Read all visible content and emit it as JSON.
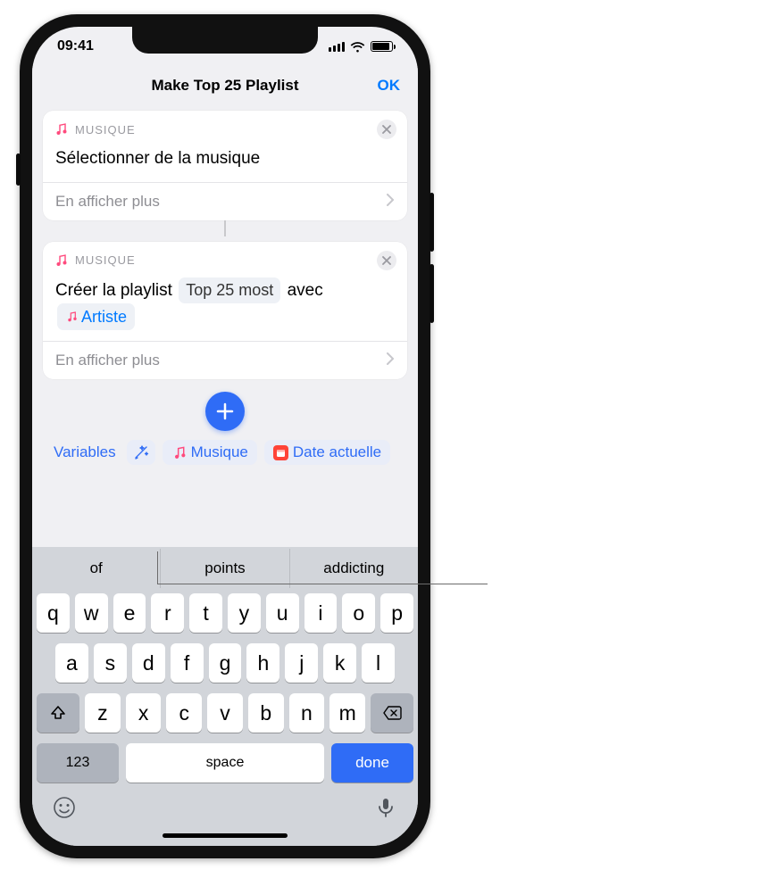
{
  "statusbar": {
    "time": "09:41"
  },
  "nav": {
    "title": "Make Top 25 Playlist",
    "ok": "OK"
  },
  "card1": {
    "app": "MUSIQUE",
    "title": "Sélectionner de la musique",
    "more": "En afficher plus"
  },
  "card2": {
    "app": "MUSIQUE",
    "line_prefix": "Créer la playlist",
    "playlist_name_pill": "Top 25 most",
    "line_mid": "avec",
    "variable_pill": "Artiste",
    "more": "En afficher plus"
  },
  "varbar": {
    "variables_link": "Variables",
    "chip_music": "Musique",
    "chip_date": "Date actuelle"
  },
  "keyboard": {
    "suggestions": [
      "of",
      "points",
      "addicting"
    ],
    "row1": [
      "q",
      "w",
      "e",
      "r",
      "t",
      "y",
      "u",
      "i",
      "o",
      "p"
    ],
    "row2": [
      "a",
      "s",
      "d",
      "f",
      "g",
      "h",
      "j",
      "k",
      "l"
    ],
    "row3": [
      "z",
      "x",
      "c",
      "v",
      "b",
      "n",
      "m"
    ],
    "num": "123",
    "space": "space",
    "done": "done"
  }
}
